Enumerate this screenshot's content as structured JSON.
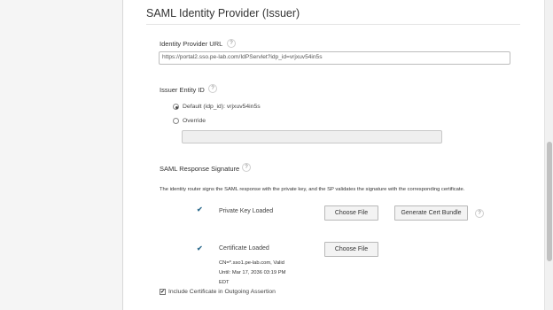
{
  "section": {
    "title": "SAML Identity Provider (Issuer)"
  },
  "idp_url": {
    "label": "Identity Provider URL",
    "value": "https://portal2.sso.pe-lab.com/IdPServlet?idp_id=vrjxuv54in5s"
  },
  "issuer": {
    "label": "Issuer Entity ID",
    "default_label": "Default (idp_id): vrjxuv54in5s",
    "override_label": "Override",
    "override_value": ""
  },
  "signature": {
    "label": "SAML Response Signature",
    "description": "The identity router signs the SAML response with the private key, and the SP validates the signature with the corresponding certificate.",
    "private_key_label": "Private Key Loaded",
    "choose_file_label": "Choose File",
    "generate_cert_label": "Generate Cert Bundle",
    "certificate_label": "Certificate Loaded",
    "cert_choose_file_label": "Choose File",
    "cert_info": {
      "cn": "CN=*.sso1.pe-lab.com, Valid",
      "until": "Until: Mar 17, 2036 03:19 PM",
      "tz": "EDT"
    },
    "include_cert_label": "Include Certificate in Outgoing Assertion"
  },
  "help_glyph": "?",
  "check_glyph": "✔",
  "icons": {
    "help": "question-circle-icon",
    "check": "checkmark-icon"
  }
}
